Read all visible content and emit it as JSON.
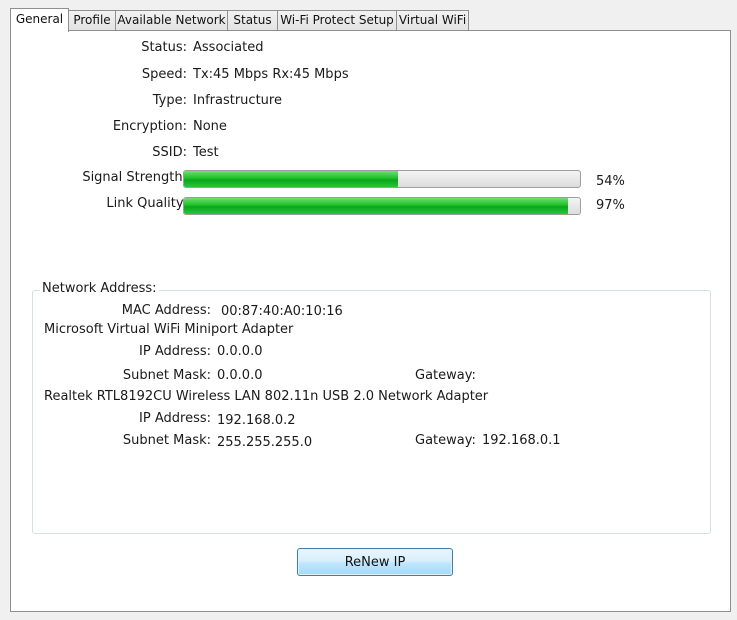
{
  "tabs": [
    {
      "label": "General",
      "active": true
    },
    {
      "label": "Profile",
      "active": false
    },
    {
      "label": "Available Network",
      "active": false
    },
    {
      "label": "Status",
      "active": false
    },
    {
      "label": "Wi-Fi Protect Setup",
      "active": false
    },
    {
      "label": "Virtual WiFi",
      "active": false
    }
  ],
  "general": {
    "status_label": "Status:",
    "status_value": "Associated",
    "speed_label": "Speed:",
    "speed_value": "Tx:45 Mbps Rx:45 Mbps",
    "type_label": "Type:",
    "type_value": "Infrastructure",
    "encryption_label": "Encryption:",
    "encryption_value": "None",
    "ssid_label": "SSID:",
    "ssid_value": "Test",
    "signal_label": "Signal Strength:",
    "signal_percent": 54,
    "signal_text": "54%",
    "link_label": "Link Quality:",
    "link_percent": 97,
    "link_text": "97%"
  },
  "network": {
    "title": "Network Address:",
    "mac_label": "MAC Address:",
    "mac_value": "00:87:40:A0:10:16",
    "adapters": [
      {
        "name": "Microsoft Virtual WiFi Miniport Adapter",
        "ip_label": "IP Address:",
        "ip_value": "0.0.0.0",
        "subnet_label": "Subnet Mask:",
        "subnet_value": "0.0.0.0",
        "gateway_label": "Gateway:",
        "gateway_value": ""
      },
      {
        "name": "Realtek RTL8192CU Wireless LAN 802.11n USB 2.0 Network Adapter",
        "ip_label": "IP Address:",
        "ip_value": "192.168.0.2",
        "subnet_label": "Subnet Mask:",
        "subnet_value": "255.255.255.0",
        "gateway_label": "Gateway:",
        "gateway_value": "192.168.0.1"
      }
    ]
  },
  "renew_button": "ReNew IP",
  "colors": {
    "bar_fill": "#1fbf2a",
    "button_border": "#3c7fb1",
    "panel_bg": "#ffffff",
    "window_bg": "#f0f0f0"
  }
}
